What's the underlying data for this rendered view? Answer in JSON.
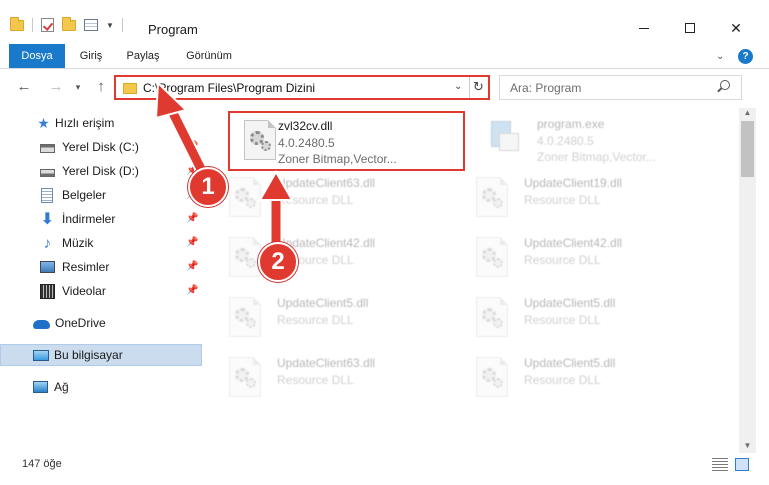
{
  "window": {
    "title": "Program",
    "controls": {
      "minimize": "—",
      "maximize": "☐",
      "close": "✕"
    }
  },
  "ribbon": {
    "tabs": [
      "Dosya",
      "Giriş",
      "Paylaş",
      "Görünüm"
    ],
    "active_tab": "Dosya",
    "help": "?"
  },
  "navigation": {
    "back": "←",
    "forward": "→",
    "recent": "▾",
    "up": "↑",
    "address": "C:\\Program Files\\Program Dizini",
    "search_placeholder": "Ara: Program"
  },
  "sidebar": {
    "items": [
      {
        "label": "Hızlı erişim",
        "icon": "star-icon"
      },
      {
        "label": "Yerel Disk (C:)",
        "icon": "drive-icon",
        "pinned": true
      },
      {
        "label": "Yerel Disk (D:)",
        "icon": "drive-icon",
        "pinned": true
      },
      {
        "label": "Belgeler",
        "icon": "documents-icon",
        "pinned": true
      },
      {
        "label": "İndirmeler",
        "icon": "download-icon",
        "pinned": true
      },
      {
        "label": "Müzik",
        "icon": "music-icon",
        "pinned": true
      },
      {
        "label": "Resimler",
        "icon": "pictures-icon",
        "pinned": true
      },
      {
        "label": "Videolar",
        "icon": "videos-icon",
        "pinned": true
      },
      {
        "label": "OneDrive",
        "icon": "onedrive-icon"
      },
      {
        "label": "Bu bilgisayar",
        "icon": "computer-icon",
        "selected": true
      },
      {
        "label": "Ağ",
        "icon": "network-icon"
      }
    ]
  },
  "files": [
    {
      "name": "zvl32cv.dll",
      "line1": "4.0.2480.5",
      "line2": "Zoner Bitmap,Vector...",
      "highlighted": true
    },
    {
      "name": "program.exe",
      "line1": "4.0.2480.5",
      "line2": "Zoner Bitmap,Vector..."
    },
    {
      "name": "UpdateClient63.dll",
      "line1": "Resource DLL"
    },
    {
      "name": "UpdateClient19.dll",
      "line1": "Resource DLL"
    },
    {
      "name": "UpdateClient42.dll",
      "line1": "Resource DLL"
    },
    {
      "name": "UpdateClient42.dll",
      "line1": "Resource DLL"
    },
    {
      "name": "UpdateClient5.dll",
      "line1": "Resource DLL"
    },
    {
      "name": "UpdateClient5.dll",
      "line1": "Resource DLL"
    },
    {
      "name": "UpdateClient63.dll",
      "line1": "Resource DLL"
    },
    {
      "name": "UpdateClient5.dll",
      "line1": "Resource DLL"
    }
  ],
  "status": {
    "item_count": "147 öğe"
  },
  "annotations": {
    "badge_1": "1",
    "badge_2": "2",
    "color": "#e0392f"
  },
  "colors": {
    "accent": "#1979ca",
    "annotation": "#e0392f",
    "selection": "#ccdcef"
  }
}
